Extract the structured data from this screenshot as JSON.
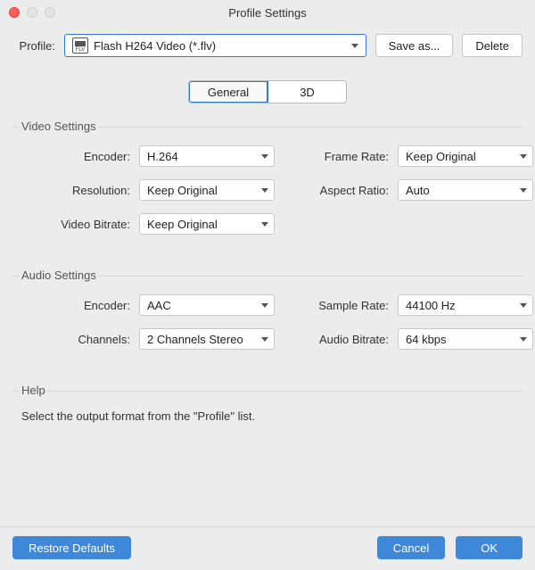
{
  "window": {
    "title": "Profile Settings"
  },
  "profile": {
    "label": "Profile:",
    "value": "Flash H264 Video (*.flv)",
    "saveAs": "Save as...",
    "delete": "Delete"
  },
  "tabs": {
    "general": "General",
    "threeD": "3D"
  },
  "video": {
    "section": "Video Settings",
    "encoderLabel": "Encoder:",
    "encoderValue": "H.264",
    "resolutionLabel": "Resolution:",
    "resolutionValue": "Keep Original",
    "bitrateLabel": "Video Bitrate:",
    "bitrateValue": "Keep Original",
    "frameRateLabel": "Frame Rate:",
    "frameRateValue": "Keep Original",
    "aspectLabel": "Aspect Ratio:",
    "aspectValue": "Auto"
  },
  "audio": {
    "section": "Audio Settings",
    "encoderLabel": "Encoder:",
    "encoderValue": "AAC",
    "channelsLabel": "Channels:",
    "channelsValue": "2 Channels Stereo",
    "sampleRateLabel": "Sample Rate:",
    "sampleRateValue": "44100 Hz",
    "bitrateLabel": "Audio Bitrate:",
    "bitrateValue": "64 kbps"
  },
  "help": {
    "section": "Help",
    "text": "Select the output format from the \"Profile\" list."
  },
  "footer": {
    "restore": "Restore Defaults",
    "cancel": "Cancel",
    "ok": "OK"
  }
}
